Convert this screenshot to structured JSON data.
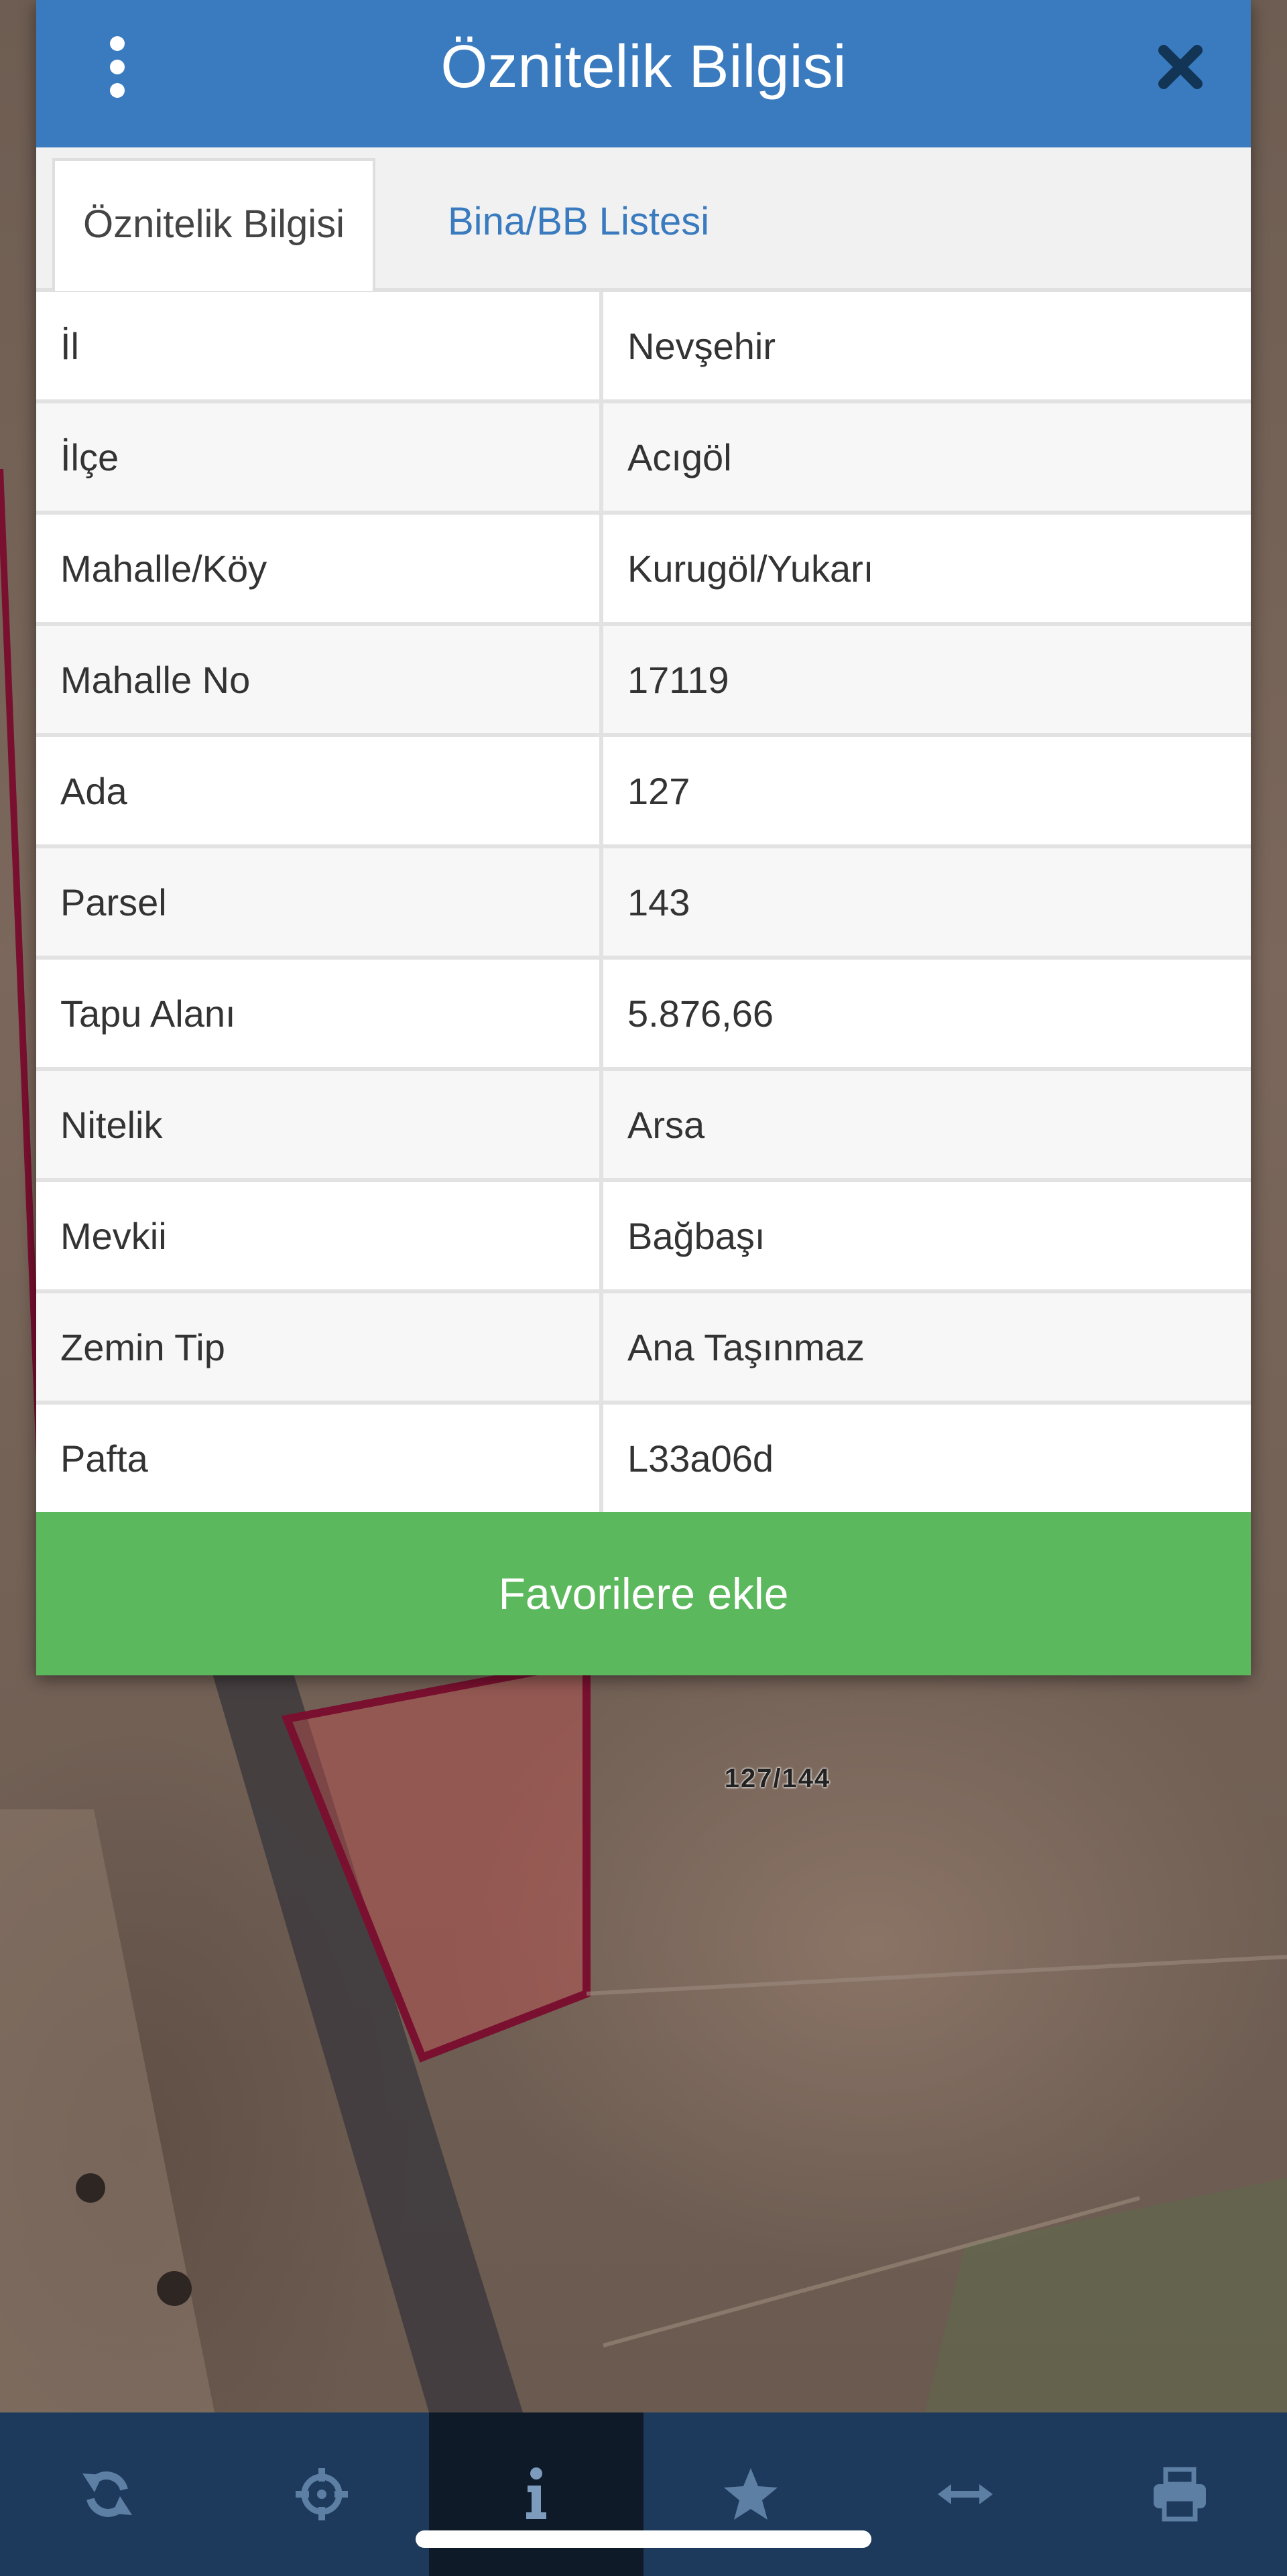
{
  "dialog": {
    "title": "Öznitelik Bilgisi",
    "tabs": [
      {
        "label": "Öznitelik Bilgisi",
        "active": true
      },
      {
        "label": "Bina/BB Listesi",
        "active": false
      }
    ],
    "rows": [
      {
        "key": "İl",
        "value": "Nevşehir"
      },
      {
        "key": "İlçe",
        "value": "Acıgöl"
      },
      {
        "key": "Mahalle/Köy",
        "value": "Kurugöl/Yukarı"
      },
      {
        "key": "Mahalle No",
        "value": "17119"
      },
      {
        "key": "Ada",
        "value": "127"
      },
      {
        "key": "Parsel",
        "value": "143"
      },
      {
        "key": "Tapu Alanı",
        "value": "5.876,66"
      },
      {
        "key": "Nitelik",
        "value": "Arsa"
      },
      {
        "key": "Mevkii",
        "value": "Bağbaşı"
      },
      {
        "key": "Zemin Tip",
        "value": "Ana Taşınmaz"
      },
      {
        "key": "Pafta",
        "value": "L33a06d"
      }
    ],
    "favorite_button": "Favorilere ekle"
  },
  "map": {
    "parcel_label": "127/144"
  },
  "toolbar": {
    "buttons": [
      {
        "icon": "refresh-icon"
      },
      {
        "icon": "crosshair-icon"
      },
      {
        "icon": "info-icon",
        "active": true
      },
      {
        "icon": "star-icon"
      },
      {
        "icon": "measure-arrows-icon"
      },
      {
        "icon": "print-icon"
      }
    ]
  },
  "colors": {
    "header": "#3a7bbf",
    "favorite": "#5cb85c",
    "toolbar": "#1d3a5c",
    "parcel_border": "#7a1030"
  }
}
